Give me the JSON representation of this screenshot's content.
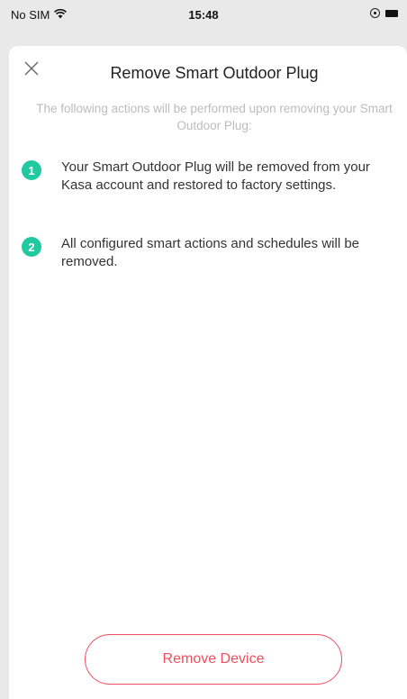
{
  "status_bar": {
    "carrier": "No SIM",
    "time": "15:48",
    "wifi_icon": "wifi-icon",
    "rotation_lock_icon": "rotation-lock-icon",
    "battery_icon": "battery-icon"
  },
  "sheet": {
    "title": "Remove Smart Outdoor Plug",
    "subtitle": "The following actions will be performed upon removing your Smart Outdoor Plug:",
    "close_icon": "close-icon",
    "steps": [
      {
        "number": "1",
        "text": "Your Smart Outdoor Plug will be removed from your Kasa account and restored to factory settings."
      },
      {
        "number": "2",
        "text": "All configured smart actions and schedules will be removed."
      }
    ],
    "remove_button_label": "Remove Device"
  },
  "colors": {
    "accent_teal": "#21c9a0",
    "danger_red": "#ef4f5f",
    "subtitle_gray": "#bcbcbc"
  }
}
